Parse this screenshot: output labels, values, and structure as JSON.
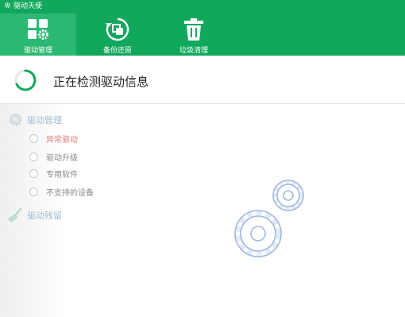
{
  "app": {
    "title": "驱动天使"
  },
  "nav": {
    "tabs": [
      {
        "label": "驱动管理",
        "icon": "apps-gear-icon",
        "active": true
      },
      {
        "label": "备份还原",
        "icon": "backup-restore-icon",
        "active": false
      },
      {
        "label": "垃圾清理",
        "icon": "trash-icon",
        "active": false
      }
    ]
  },
  "status": {
    "text": "正在检测驱动信息"
  },
  "sidebar": {
    "section_manage": "驱动管理",
    "items": [
      {
        "label": "异常驱动"
      },
      {
        "label": "驱动升级"
      },
      {
        "label": "专用软件"
      },
      {
        "label": "不支持的设备"
      }
    ],
    "section_residual": "驱动残留"
  },
  "colors": {
    "header": "#12a85c",
    "active_tab": "#2bb873",
    "error_text": "#e07a7a",
    "gear_outline": "#8aa8d8"
  }
}
